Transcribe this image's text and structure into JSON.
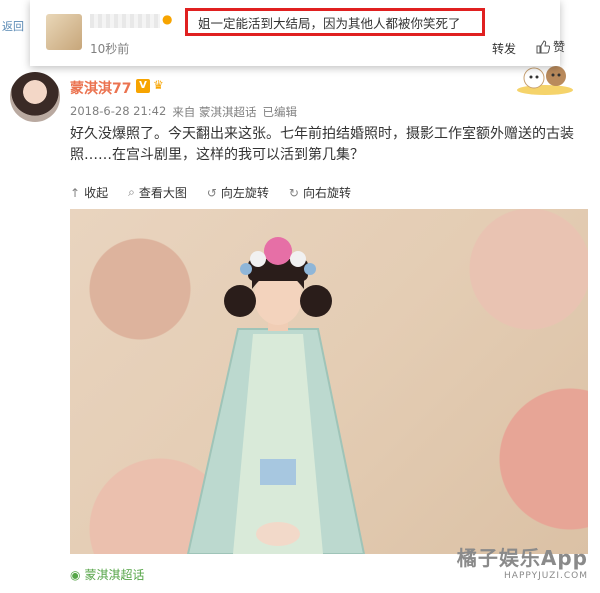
{
  "popup": {
    "back_label": "返回",
    "comment": "姐一定能活到大结局，因为其他人都被你笑死了",
    "time": "10秒前",
    "repost_label": "转发",
    "like_label": "赞",
    "highlight_color": "#e02020"
  },
  "post": {
    "username": "蒙淇淇77",
    "verified_badge": "V",
    "date": "2018-6-28 21:42",
    "source": "来自 蒙淇淇超话",
    "edited": "已编辑",
    "text": "好久没爆照了。今天翻出来这张。七年前拍结婚照时，摄影工作室额外赠送的古装照……在宫斗剧里，这样的我可以活到第几集？",
    "actions": [
      {
        "icon": "up-arrow-icon",
        "label": "收起"
      },
      {
        "icon": "magnify-icon",
        "label": "查看大图"
      },
      {
        "icon": "rotate-left-icon",
        "label": "向左旋转"
      },
      {
        "icon": "rotate-right-icon",
        "label": "向右旋转"
      }
    ],
    "supertopic": "蒙淇淇超话"
  },
  "watermark": {
    "main": "橘子娱乐App",
    "sub": "HAPPYJUZI.COM"
  },
  "colors": {
    "username": "#eb7350",
    "badge": "#f7a400",
    "supertopic": "#56a548"
  }
}
